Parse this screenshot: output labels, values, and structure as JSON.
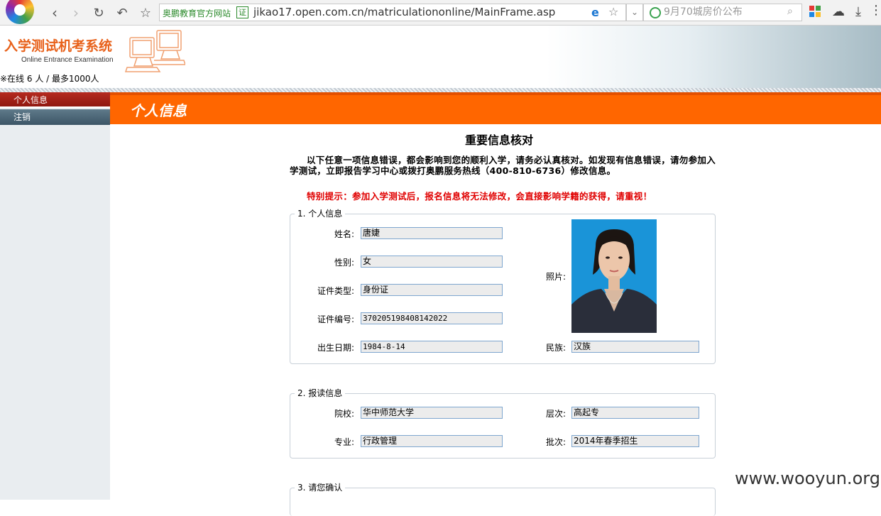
{
  "browser": {
    "site_badge": "奥鹏教育官方网站",
    "cert_label": "证",
    "url": "jikao17.open.com.cn/matriculationonline/MainFrame.asp",
    "search_placeholder": "9月70城房价公布"
  },
  "header": {
    "title": "入学测试机考系统",
    "subtitle": "Online Entrance Examination",
    "online_status": "※在线 6 人 / 最多1000人"
  },
  "sidebar": {
    "items": [
      {
        "label": "个人信息"
      },
      {
        "label": "注销"
      }
    ]
  },
  "banner": {
    "title": "个人信息"
  },
  "main": {
    "title": "重要信息核对",
    "notice": "以下任意一项信息错误，都会影响到您的顺利入学，请务必认真核对。如发现有信息错误，请勿参加入学测试，立即报告学习中心或拨打奥鹏服务热线（400-810-6736）修改信息。",
    "warning": "特别提示：参加入学测试后，报名信息将无法修改，会直接影响学籍的获得，请重视！"
  },
  "section1": {
    "legend": "1. 个人信息",
    "name_label": "姓名:",
    "name_value": "唐婕",
    "gender_label": "性别:",
    "gender_value": "女",
    "idtype_label": "证件类型:",
    "idtype_value": "身份证",
    "idno_label": "证件编号:",
    "idno_value": "370205198408142022",
    "birth_label": "出生日期:",
    "birth_value": "1984-8-14",
    "photo_label": "照片:",
    "ethnic_label": "民族:",
    "ethnic_value": "汉族"
  },
  "section2": {
    "legend": "2. 报读信息",
    "school_label": "院校:",
    "school_value": "华中师范大学",
    "level_label": "层次:",
    "level_value": "高起专",
    "major_label": "专业:",
    "major_value": "行政管理",
    "batch_label": "批次:",
    "batch_value": "2014年春季招生"
  },
  "section3": {
    "legend": "3. 请您确认"
  },
  "watermark": "www.wooyun.org"
}
